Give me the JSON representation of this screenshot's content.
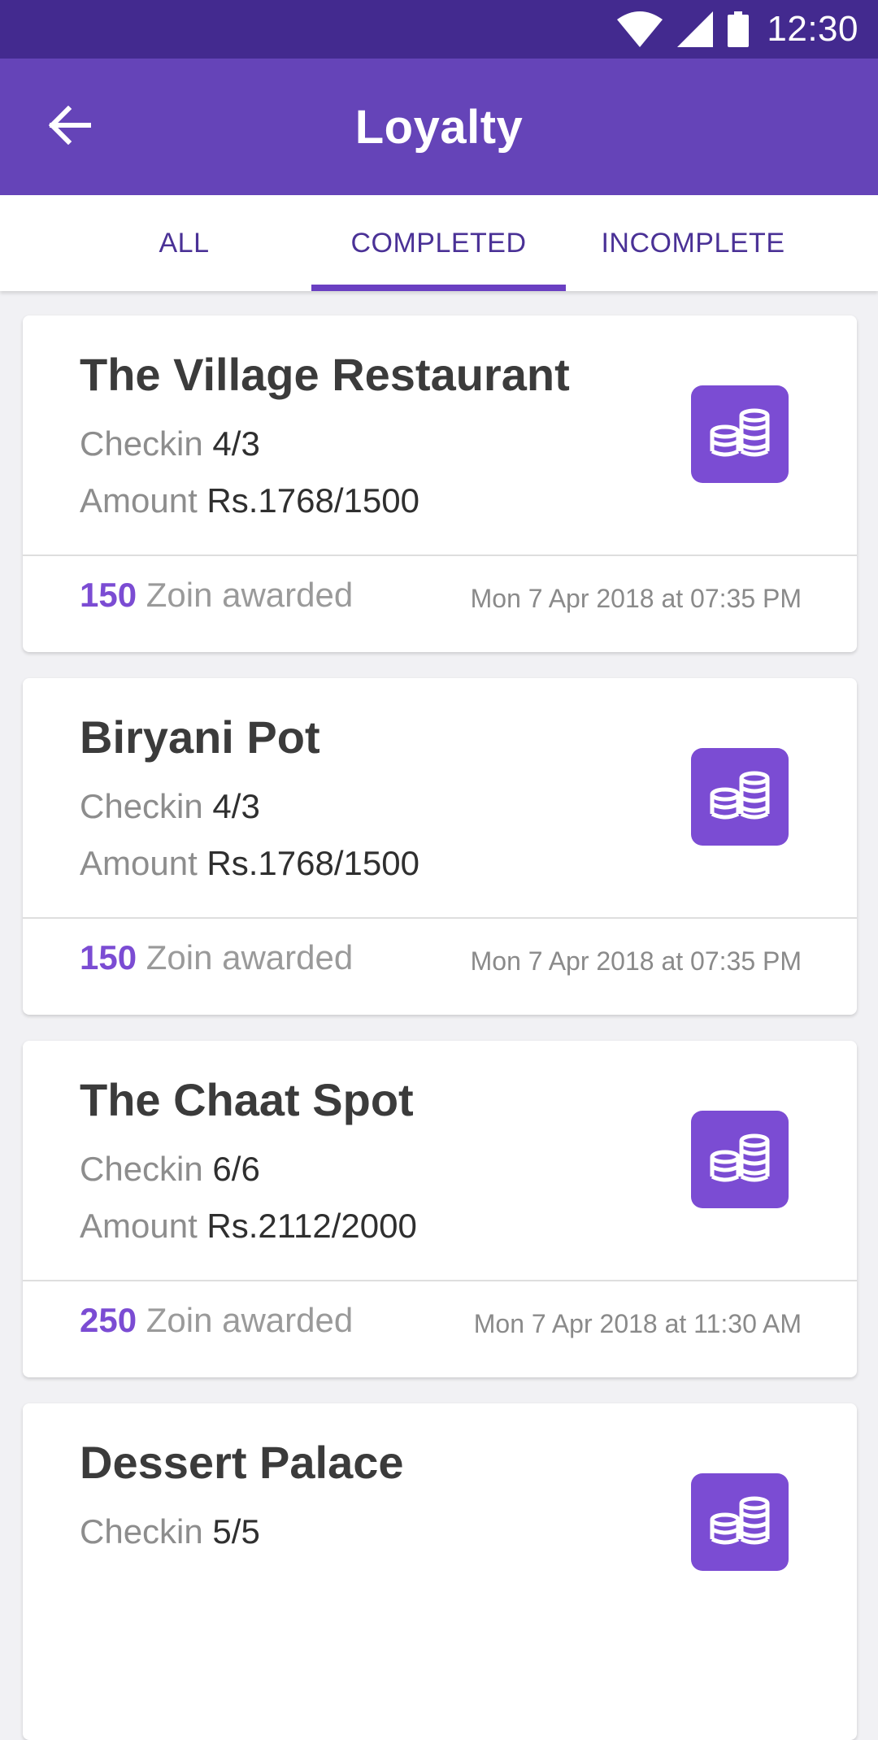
{
  "status_bar": {
    "time": "12:30",
    "icons": [
      "wifi-icon",
      "signal-icon",
      "battery-icon"
    ]
  },
  "app_bar": {
    "back_icon": "arrow-left-icon",
    "title": "Loyalty"
  },
  "tabs": [
    {
      "label": "ALL",
      "active": false
    },
    {
      "label": "COMPLETED",
      "active": true
    },
    {
      "label": "INCOMPLETE",
      "active": false
    }
  ],
  "cards": [
    {
      "name": "The Village Restaurant",
      "checkin_label": "Checkin",
      "checkin_value": "4/3",
      "amount_label": "Amount",
      "amount_value": "Rs.1768/1500",
      "points": "150",
      "points_label": "Zoin awarded",
      "date": "Mon 7 Apr 2018 at 07:35 PM",
      "icon": "coins-icon"
    },
    {
      "name": "Biryani Pot",
      "checkin_label": "Checkin",
      "checkin_value": "4/3",
      "amount_label": "Amount",
      "amount_value": "Rs.1768/1500",
      "points": "150",
      "points_label": "Zoin awarded",
      "date": "Mon 7 Apr 2018 at 07:35 PM",
      "icon": "coins-icon"
    },
    {
      "name": "The Chaat Spot",
      "checkin_label": "Checkin",
      "checkin_value": "6/6",
      "amount_label": "Amount",
      "amount_value": "Rs.2112/2000",
      "points": "250",
      "points_label": "Zoin awarded",
      "date": "Mon 7 Apr 2018 at 11:30 AM",
      "icon": "coins-icon"
    },
    {
      "name": "Dessert Palace",
      "checkin_label": "Checkin",
      "checkin_value": "5/5",
      "icon": "coins-icon"
    }
  ],
  "colors": {
    "status_bar": "#432a8f",
    "app_bar": "#6544b8",
    "accent": "#7b4cd3",
    "tab_text": "#4a3196"
  }
}
